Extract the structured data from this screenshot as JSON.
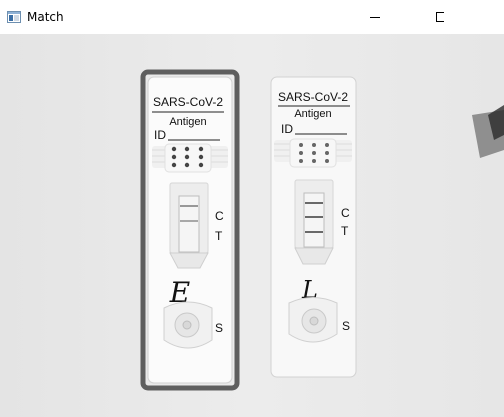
{
  "window": {
    "title": "Match",
    "icons": {
      "app": "app-window-icon",
      "minimize": "minimize-icon",
      "maximize": "maximize-icon",
      "close": "close-icon"
    }
  },
  "image": {
    "cassettes": [
      {
        "name": "left-test-cassette",
        "heading": "SARS-CoV-2",
        "subheading": "Antigen",
        "id_label": "ID",
        "c_label": "C",
        "t_label": "T",
        "s_label": "S",
        "handwritten_mark": "E",
        "highlighted": true,
        "highlight_color": "#5f5f5f"
      },
      {
        "name": "right-test-cassette",
        "heading": "SARS-CoV-2",
        "subheading": "Antigen",
        "id_label": "ID",
        "c_label": "C",
        "t_label": "T",
        "s_label": "S",
        "handwritten_mark": "L",
        "highlighted": false
      }
    ]
  }
}
